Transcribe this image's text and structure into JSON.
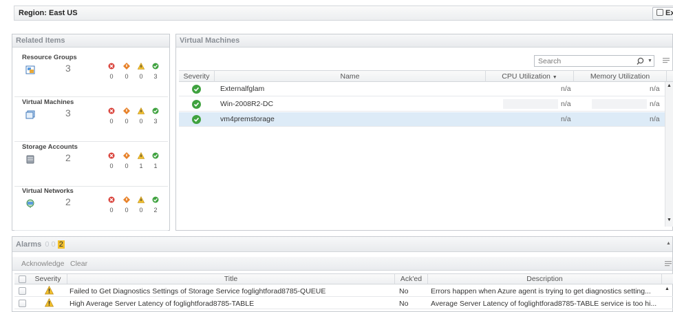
{
  "header": {
    "title": "Region: East US",
    "explore_label": "Explo"
  },
  "related": {
    "title": "Related Items",
    "items": [
      {
        "name": "Resource Groups",
        "count": "3",
        "sev": [
          "0",
          "0",
          "0",
          "3"
        ],
        "icon": "resource-group-icon"
      },
      {
        "name": "Virtual Machines",
        "count": "3",
        "sev": [
          "0",
          "0",
          "0",
          "3"
        ],
        "icon": "virtual-machine-icon"
      },
      {
        "name": "Storage Accounts",
        "count": "2",
        "sev": [
          "0",
          "0",
          "1",
          "1"
        ],
        "icon": "storage-account-icon"
      },
      {
        "name": "Virtual Networks",
        "count": "2",
        "sev": [
          "0",
          "0",
          "0",
          "2"
        ],
        "icon": "virtual-network-icon"
      }
    ]
  },
  "vms": {
    "title": "Virtual Machines",
    "search_placeholder": "Search",
    "columns": {
      "severity": "Severity",
      "name": "Name",
      "cpu": "CPU Utilization",
      "memory": "Memory Utilization"
    },
    "rows": [
      {
        "name": "Externalfglam",
        "cpu": "n/a",
        "memory": "n/a"
      },
      {
        "name": "Win-2008R2-DC",
        "cpu": "n/a",
        "memory": "n/a"
      },
      {
        "name": "vm4premstorage",
        "cpu": "n/a",
        "memory": "n/a"
      }
    ]
  },
  "alarms": {
    "title": "Alarms",
    "counts": [
      "0",
      "0",
      "2"
    ],
    "acknowledge": "Acknowledge",
    "clear": "Clear",
    "columns": {
      "severity": "Severity",
      "title": "Title",
      "acked": "Ack'ed",
      "description": "Description"
    },
    "rows": [
      {
        "title": "Failed to Get Diagnostics Settings of Storage Service foglightforad8785-QUEUE",
        "acked": "No",
        "description": "Errors happen when Azure agent is trying to get diagnostics setting..."
      },
      {
        "title": "High Average Server Latency of foglightforad8785-TABLE",
        "acked": "No",
        "description": "Average Server Latency of foglightforad8785-TABLE service is too hi..."
      }
    ]
  },
  "colors": {
    "critical": "#d9413a",
    "major": "#e8822a",
    "warning": "#f2c02c",
    "normal": "#3fa23f",
    "selected_row": "#ddebf7"
  }
}
